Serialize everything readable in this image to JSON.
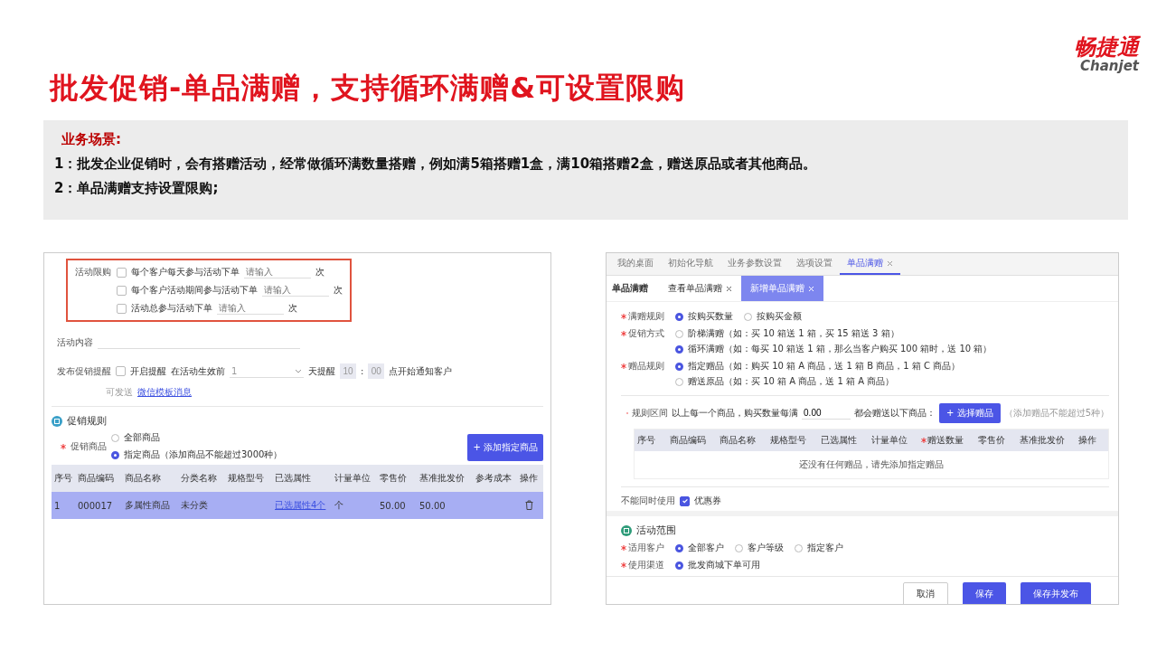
{
  "logo": {
    "brand_cn": "畅捷通",
    "brand_en": "Chanjet"
  },
  "title": "批发促销-单品满赠，支持循环满赠&可设置限购",
  "scenario": {
    "heading": "业务场景:",
    "lines": [
      "1：批发企业促销时，会有搭赠活动，经常做循环满数量搭赠，例如满5箱搭赠1盒，满10箱搭赠2盒，赠送原品或者其他商品。",
      "2：单品满赠支持设置限购;"
    ]
  },
  "left_screen": {
    "purchase_limit": {
      "label": "活动限购",
      "options": [
        {
          "label": "每个客户每天参与活动下单",
          "checked": false,
          "placeholder": "请输入",
          "unit": "次"
        },
        {
          "label": "每个客户活动期间参与活动下单",
          "checked": false,
          "placeholder": "请输入",
          "unit": "次"
        },
        {
          "label": "活动总参与活动下单",
          "checked": false,
          "placeholder": "请输入",
          "unit": "次"
        }
      ]
    },
    "content": {
      "label": "活动内容"
    },
    "reminder": {
      "label": "发布促销提醒",
      "toggle": {
        "label": "开启提醒",
        "checked": false
      },
      "prefix": "在活动生效前",
      "select_value": "1",
      "days_label": "天提醒",
      "hour": "10",
      "time_separator": ":",
      "minute": "00",
      "suffix": "点开始通知客户",
      "note": "可发送",
      "note_link": "微信模板消息"
    },
    "rules": {
      "title": "促销规则",
      "field_label": "促销商品",
      "required": true,
      "options": [
        {
          "label": "全部商品",
          "selected": false
        },
        {
          "label": "指定商品（添加商品不能超过3000种）",
          "selected": true
        }
      ],
      "add_button": "+ 添加指定商品",
      "columns": [
        "序号",
        "商品编码",
        "商品名称",
        "分类名称",
        "规格型号",
        "已选属性",
        "计量单位",
        "零售价",
        "基准批发价",
        "参考成本",
        "操作"
      ],
      "rows": [
        {
          "seq": "1",
          "code": "000017",
          "name": "多属性商品",
          "category": "未分类",
          "attributes": "已选属性4个",
          "unit": "个",
          "retail_price": "50.00",
          "wholesale_price": "50.00",
          "selected": true
        }
      ]
    }
  },
  "right_screen": {
    "top_tabs": [
      {
        "label": "我的桌面",
        "selected": false,
        "closable": false
      },
      {
        "label": "初始化导航",
        "selected": false,
        "closable": false
      },
      {
        "label": "业务参数设置",
        "selected": false,
        "closable": false
      },
      {
        "label": "选项设置",
        "selected": false,
        "closable": false
      },
      {
        "label": "单品满赠",
        "selected": true,
        "closable": true
      }
    ],
    "page_title": "单品满赠",
    "sub_tabs": [
      {
        "label": "查看单品满赠",
        "selected": false
      },
      {
        "label": "新增单品满赠",
        "selected": true
      }
    ],
    "form_rows": [
      {
        "label": "满赠规则",
        "required": true,
        "options": [
          {
            "label": "按购买数量",
            "selected": true
          },
          {
            "label": "按购买金额",
            "selected": false
          }
        ]
      },
      {
        "label": "促销方式",
        "required": true,
        "options": [
          {
            "label": "阶梯满赠（如：买 10 箱送 1 箱，买 15 箱送 3 箱）",
            "selected": false
          },
          {
            "label": "循环满赠（如：每买 10 箱送 1 箱，那么当客户购买 100 箱时，送 10 箱）",
            "selected": true
          }
        ]
      },
      {
        "label": "赠品规则",
        "required": true,
        "options": [
          {
            "label": "指定赠品（如：购买 10 箱 A 商品，送 1 箱 B 商品，1 箱 C 商品）",
            "selected": true
          },
          {
            "label": "赠送原品（如：买 10 箱 A 商品，送 1 箱 A 商品）",
            "selected": false
          }
        ]
      }
    ],
    "rule_range": {
      "label": "规则区间",
      "required": true,
      "text": "以上每一个商品，购买数量每满",
      "value": "0.00",
      "text_after": "都会赠送以下商品：",
      "button": "+ 选择赠品",
      "note": "（添加赠品不能超过5种）"
    },
    "gift_table": {
      "columns": [
        {
          "label": "序号",
          "required": false
        },
        {
          "label": "商品编码",
          "required": false
        },
        {
          "label": "商品名称",
          "required": false
        },
        {
          "label": "规格型号",
          "required": false
        },
        {
          "label": "已选属性",
          "required": false
        },
        {
          "label": "计量单位",
          "required": false
        },
        {
          "label": "赠送数量",
          "required": true
        },
        {
          "label": "零售价",
          "required": false
        },
        {
          "label": "基准批发价",
          "required": false
        },
        {
          "label": "操作",
          "required": false
        }
      ],
      "empty_text": "还没有任何赠品，请先添加指定赠品"
    },
    "exclusive": {
      "label": "不能同时使用",
      "option": {
        "label": "优惠券",
        "checked": true
      }
    },
    "scope": {
      "title": "活动范围",
      "rows": [
        {
          "label": "适用客户",
          "required": true,
          "options": [
            {
              "label": "全部客户",
              "selected": true
            },
            {
              "label": "客户等级",
              "selected": false
            },
            {
              "label": "指定客户",
              "selected": false
            }
          ]
        },
        {
          "label": "使用渠道",
          "required": true,
          "options": [
            {
              "label": "批发商城下单可用",
              "selected": true
            }
          ]
        }
      ]
    },
    "footer_buttons": [
      {
        "label": "取消",
        "kind": "secondary"
      },
      {
        "label": "保存",
        "kind": "primary"
      },
      {
        "label": "保存并发布",
        "kind": "primary"
      }
    ]
  }
}
